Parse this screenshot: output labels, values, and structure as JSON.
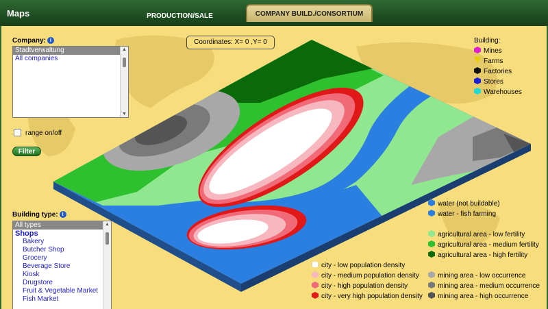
{
  "header": {
    "title": "Maps",
    "tabs": [
      {
        "label": "PRODUCTION/SALE",
        "active": false
      },
      {
        "label": "COMPANY BUILD./CONSORTIUM",
        "active": true
      }
    ]
  },
  "company": {
    "label": "Company:",
    "items": [
      "Stadtverwaltung",
      "All companies"
    ],
    "selected": "Stadtverwaltung"
  },
  "range": {
    "label": "range on/off",
    "checked": false
  },
  "filter": {
    "label": "Filter"
  },
  "coordinates": {
    "text": "Coordinates: X= 0 ,Y= 0"
  },
  "building_legend": {
    "title": "Building:",
    "items": [
      {
        "label": "Mines",
        "color": "#e020d0"
      },
      {
        "label": "Farms",
        "color": "#e8d000"
      },
      {
        "label": "Factories",
        "color": "#111111"
      },
      {
        "label": "Stores",
        "color": "#1a20d8"
      },
      {
        "label": "Warehouses",
        "color": "#20d8d8"
      }
    ]
  },
  "building_type": {
    "label": "Building type:",
    "items": [
      {
        "label": "All types",
        "kind": "selected"
      },
      {
        "label": "Shops",
        "kind": "group"
      },
      {
        "label": "Bakery",
        "kind": "sub"
      },
      {
        "label": "Butcher Shop",
        "kind": "sub"
      },
      {
        "label": "Grocery",
        "kind": "sub"
      },
      {
        "label": "Beverage Store",
        "kind": "sub"
      },
      {
        "label": "Kiosk",
        "kind": "sub"
      },
      {
        "label": "Drugstore",
        "kind": "sub"
      },
      {
        "label": "Fruit & Vegetable Market",
        "kind": "sub"
      },
      {
        "label": "Fish Market",
        "kind": "sub"
      }
    ]
  },
  "terrain_legend": {
    "water": [
      {
        "label": "water (not buildable)",
        "color": "#2a7fe0"
      },
      {
        "label": "water - fish farming",
        "color": "#2a7fe0"
      }
    ],
    "agriculture": [
      {
        "label": "agricultural area - low fertility",
        "color": "#8fe88f"
      },
      {
        "label": "agricultural area - medium fertility",
        "color": "#2fc02f"
      },
      {
        "label": "agricultural area - high fertility",
        "color": "#0a6a0a"
      }
    ],
    "city": [
      {
        "label": "city - low population density",
        "color": "#ffffff"
      },
      {
        "label": "city - medium population density",
        "color": "#f7b7bf"
      },
      {
        "label": "city - high population density",
        "color": "#f06a78"
      },
      {
        "label": "city - very high population density",
        "color": "#e01818"
      }
    ],
    "mining": [
      {
        "label": "mining area - low occurrence",
        "color": "#a8a8a8"
      },
      {
        "label": "mining area - medium occurrence",
        "color": "#7a7a7a"
      },
      {
        "label": "mining area - high occurrence",
        "color": "#555555"
      }
    ]
  }
}
